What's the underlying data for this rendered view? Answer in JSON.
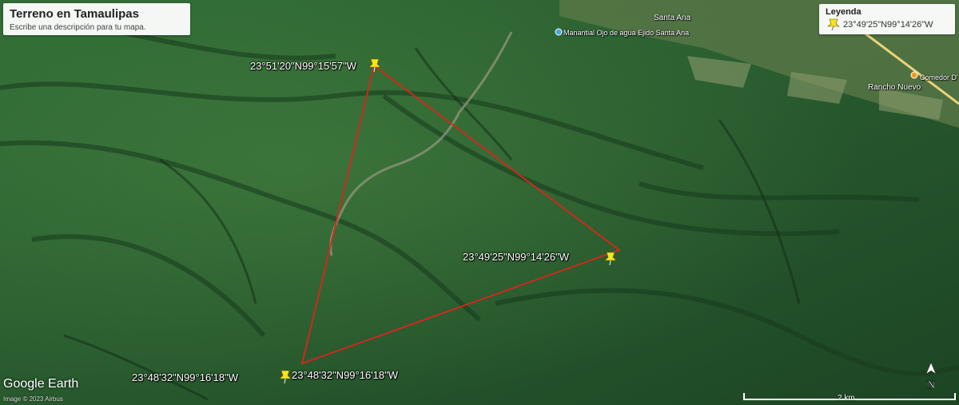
{
  "map": {
    "title": "Terreno en Tamaulipas",
    "description": "Escribe una descripción para tu mapa."
  },
  "legend": {
    "title": "Leyenda",
    "item": "23°49'25\"N99°14'26\"W"
  },
  "placemarks": {
    "north": "23°51'20\"N99°15'57\"W",
    "east": "23°49'25\"N99°14'26\"W",
    "south_left": "23°48'32\"N99°16'18\"W",
    "south_right": "23°48'32\"N99°16'18\"W"
  },
  "places": {
    "santa_ana": "Santa Ana",
    "manantial": "Manantial Ojo de agua Ejido Santa Ana",
    "rancho": "Rancho Nuevo",
    "comedor": "Comedor D'"
  },
  "branding": {
    "logo": "Google Earth",
    "attribution": "Image © 2023 Airbus"
  },
  "scale": {
    "label": "2 km"
  },
  "compass": {
    "label": "N"
  },
  "colors": {
    "boundary": "#e0231a",
    "pin": "#f7e51a",
    "terrain": "#2b5a2f"
  }
}
